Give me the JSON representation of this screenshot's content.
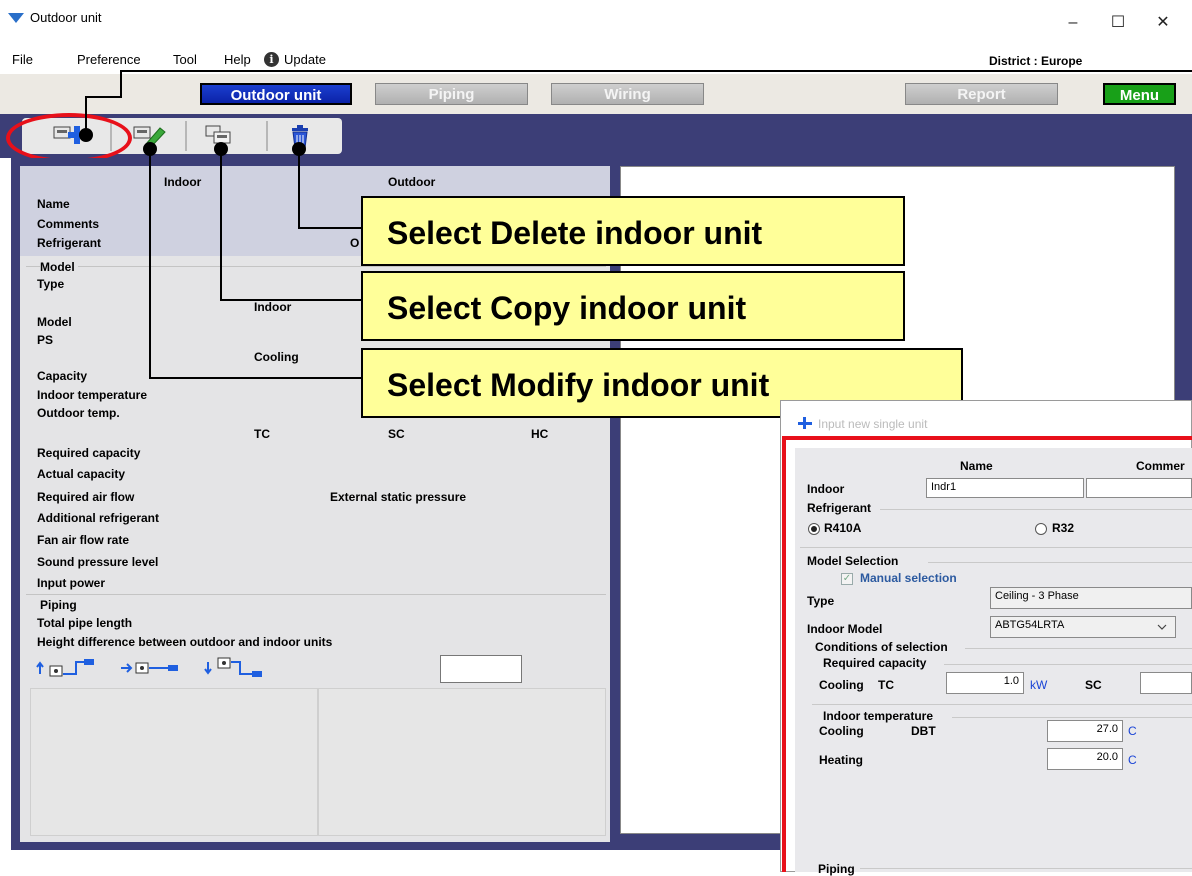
{
  "window": {
    "title": "Outdoor unit",
    "minimize": "–",
    "maximize": "☐",
    "close": "✕"
  },
  "menu": {
    "items": [
      "File",
      "Preference",
      "Tool",
      "Help"
    ],
    "update_icon": "i",
    "update": "Update",
    "district": "District : Europe"
  },
  "nav": {
    "outdoor_unit": "Outdoor unit",
    "piping": "Piping",
    "wiring": "Wiring",
    "report": "Report",
    "menu": "Menu"
  },
  "toolbar": {
    "icons": [
      "add-indoor-unit-icon",
      "modify-indoor-unit-icon",
      "copy-indoor-unit-icon",
      "delete-indoor-unit-icon"
    ]
  },
  "form": {
    "col_indoor": "Indoor",
    "col_outdoor": "Outdoor",
    "name": "Name",
    "comments": "Comments",
    "refrigerant": "Refrigerant",
    "refrigerant_value_partial": "O",
    "model_section": "Model",
    "type": "Type",
    "indoor_partial": "Indoor",
    "model": "Model",
    "ps": "PS",
    "cooling": "Cooling",
    "capacity": "Capacity",
    "indoor_temperature": "Indoor temperature",
    "outdoor_temp": "Outdoor temp.",
    "tc": "TC",
    "sc": "SC",
    "hc": "HC",
    "required_capacity": "Required capacity",
    "actual_capacity": "Actual capacity",
    "required_air_flow": "Required air flow",
    "external_static_pressure": "External static pressure",
    "additional_refrigerant": "Additional refrigerant",
    "fan_air_flow_rate": "Fan air flow rate",
    "sound_pressure_level": "Sound pressure level",
    "input_power": "Input power",
    "piping_section": "Piping",
    "total_pipe_length": "Total pipe length",
    "height_difference": "Height difference between outdoor and indoor units"
  },
  "callouts": {
    "delete": "Select Delete indoor unit",
    "copy": "Select Copy indoor unit",
    "modify": "Select Modify indoor unit"
  },
  "dialog": {
    "title": "Input new single unit",
    "col_name": "Name",
    "col_comments": "Commer",
    "indoor": "Indoor",
    "name_value": "Indr1",
    "comments_value": "",
    "refrigerant": "Refrigerant",
    "r410a": "R410A",
    "r32": "R32",
    "selected_refrigerant": "R410A",
    "model_selection": "Model Selection",
    "manual_selection": "Manual selection",
    "manual_checked": true,
    "type": "Type",
    "type_value": "Ceiling - 3 Phase",
    "indoor_model": "Indoor Model",
    "indoor_model_value": "ABTG54LRTA",
    "conditions_of_selection": "Conditions of selection",
    "required_capacity": "Required capacity",
    "cooling": "Cooling",
    "tc": "TC",
    "tc_value": "1.0",
    "kw": "kW",
    "sc": "SC",
    "sc_value": "",
    "indoor_temperature": "Indoor temperature",
    "dbt": "DBT",
    "cooling_dbt_value": "27.0",
    "heating": "Heating",
    "heating_dbt_value": "20.0",
    "celsius": "C",
    "piping": "Piping"
  },
  "colors": {
    "band": "#3c3e77",
    "nav_active": "#0b22a8",
    "menu_green": "#18a018",
    "callout_fill": "#ffff99",
    "highlight_red": "#e8101a",
    "unit_blue": "#1a44d6"
  }
}
